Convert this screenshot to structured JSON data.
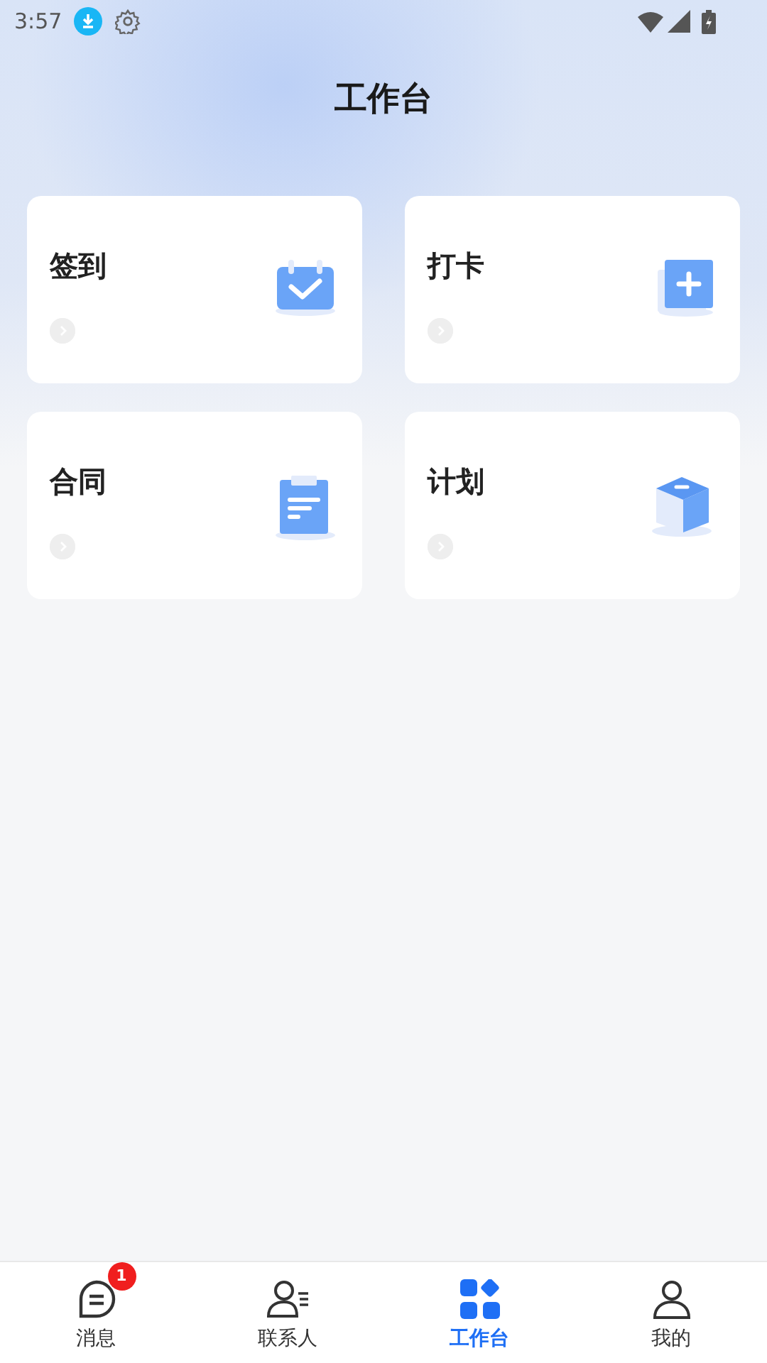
{
  "status_bar": {
    "time": "3:57"
  },
  "header": {
    "title": "工作台"
  },
  "cards": [
    {
      "label": "签到",
      "kind": "calendar"
    },
    {
      "label": "打卡",
      "kind": "add"
    },
    {
      "label": "合同",
      "kind": "clipboard"
    },
    {
      "label": "计划",
      "kind": "cube"
    }
  ],
  "tabs": [
    {
      "label": "消息",
      "kind": "message",
      "selected": false,
      "badge": "1"
    },
    {
      "label": "联系人",
      "kind": "contacts",
      "selected": false
    },
    {
      "label": "工作台",
      "kind": "workbench",
      "selected": true
    },
    {
      "label": "我的",
      "kind": "profile",
      "selected": false
    }
  ]
}
